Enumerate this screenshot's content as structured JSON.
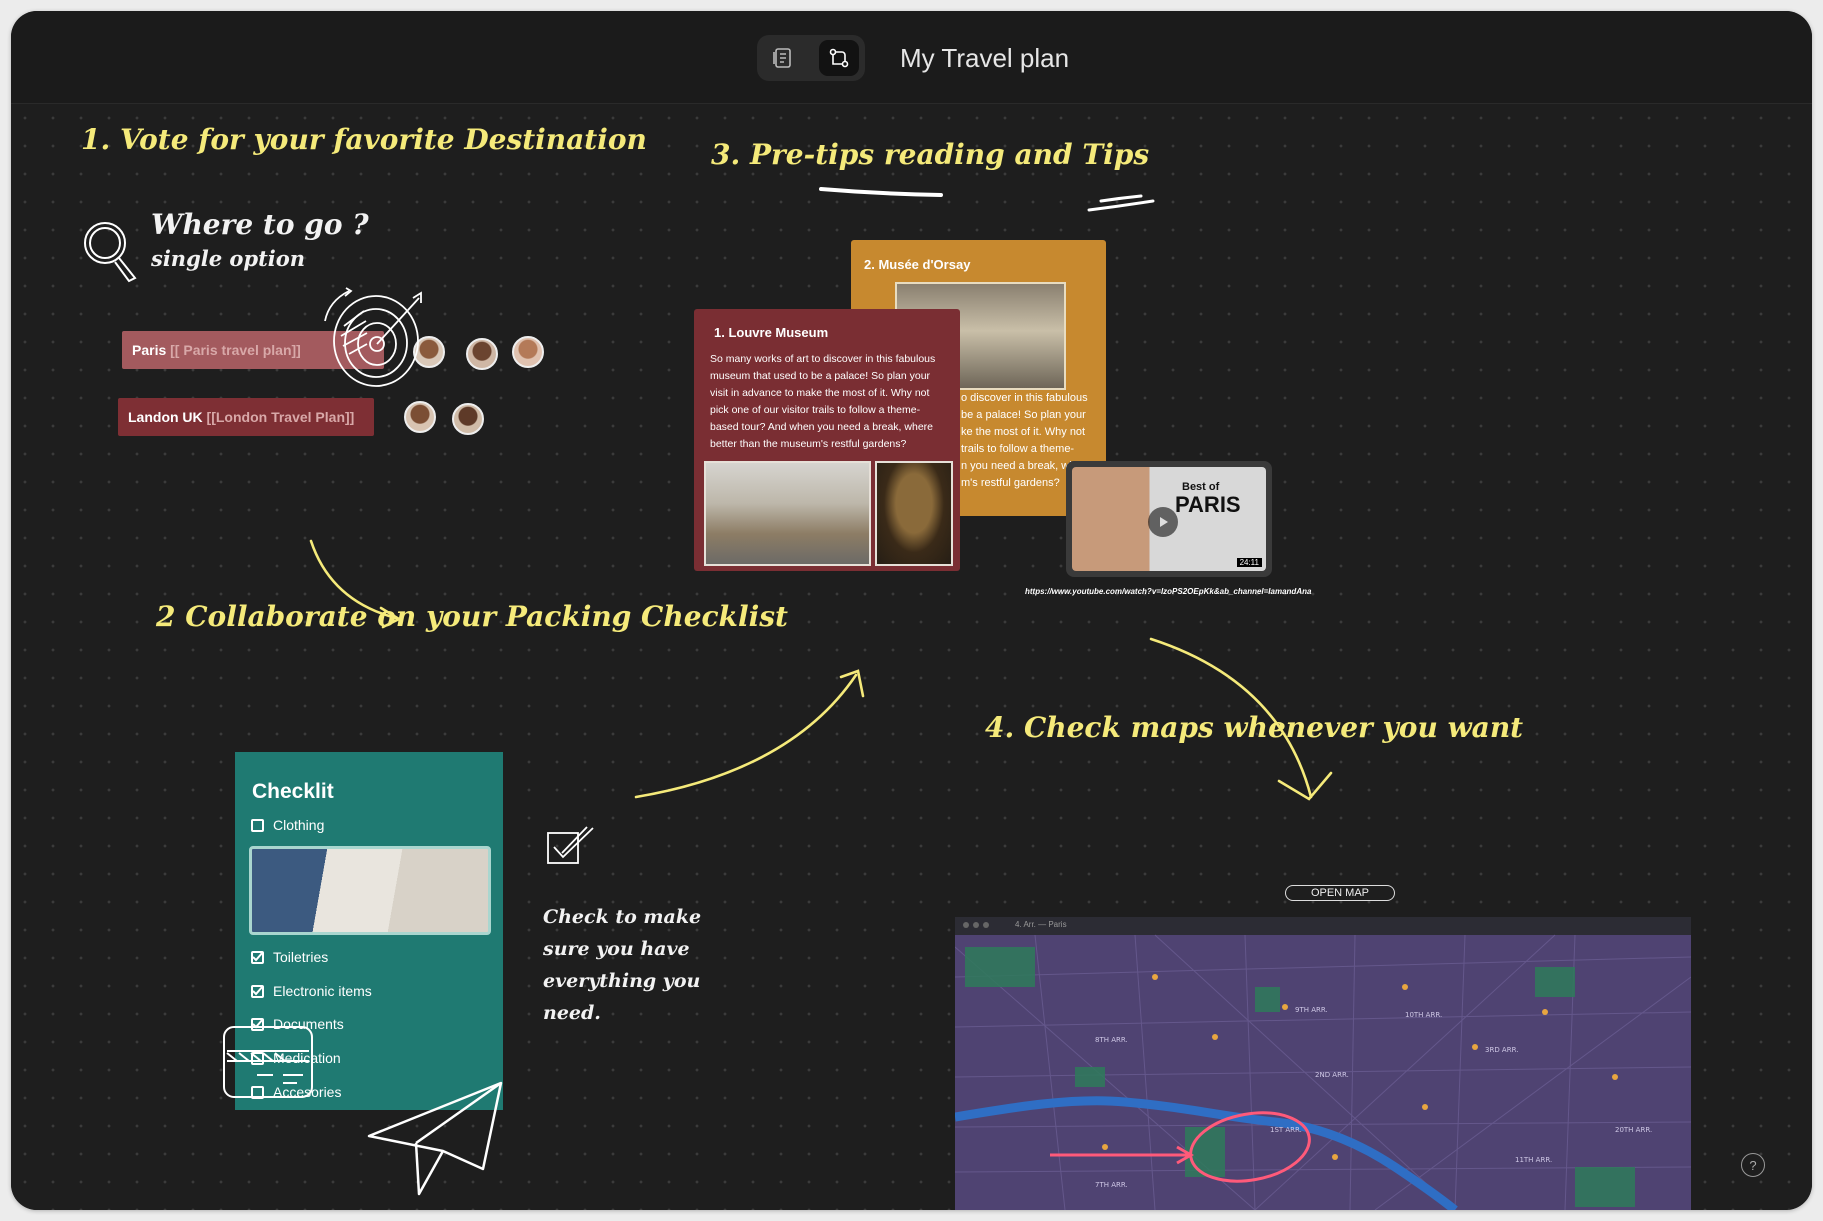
{
  "app": {
    "title": "My Travel plan",
    "view_buttons": [
      "doc-view",
      "whiteboard-view"
    ],
    "active_view": "whiteboard-view"
  },
  "section1": {
    "heading": "1. Vote for your favorite Destination",
    "question": "Where to go ?",
    "subtitle": "single option",
    "options": [
      {
        "name": "Paris",
        "link": "[[ Paris travel plan]]",
        "votes": 3,
        "color": "#a35a5e"
      },
      {
        "name": "Landon UK",
        "link": "[[London Travel Plan]]",
        "votes": 2,
        "color": "#7e2f34"
      }
    ]
  },
  "section2": {
    "heading": "2 Collaborate on your Packing Checklist",
    "checklist_title": "Checklit",
    "items": [
      {
        "label": "Clothing",
        "checked": false
      },
      {
        "label": "Toiletries",
        "checked": true
      },
      {
        "label": "Electronic items",
        "checked": true
      },
      {
        "label": "Documents",
        "checked": true
      },
      {
        "label": "Medication",
        "checked": false
      },
      {
        "label": "Accesories",
        "checked": false
      }
    ],
    "note_lines": [
      "Check to make",
      "sure you have",
      "everything you",
      "need."
    ],
    "color": "#1f7a72"
  },
  "section3": {
    "heading": "3. Pre-tips reading and Tips",
    "card_louvre": {
      "title": "1. Louvre Museum",
      "text_lines": [
        "So many works of art to discover in this fabulous",
        "museum that used to be a palace! So plan your",
        "visit in advance to make the most of it. Why not",
        "pick one of our visitor trails to follow a theme-",
        "based tour? And when you need a break, where",
        "better than the museum's restful gardens?"
      ],
      "color": "#7a2e33"
    },
    "card_orsay": {
      "title": "2. Musée d'Orsay",
      "text_lines": [
        "o discover in this fabulous",
        "be a palace! So plan your",
        "ke the most of it. Why not",
        "trails to follow a theme-",
        "n you need a break, wh",
        "m's restful gardens?"
      ],
      "color": "#c7892f"
    },
    "video": {
      "caption_top": "Best of",
      "caption_main": "PARIS",
      "duration": "24:11",
      "url": "https://www.youtube.com/watch?v=IzoPS2OEpKk&ab_channel=IamandAna"
    }
  },
  "section4": {
    "heading": "4. Check maps whenever you want",
    "open_map_label": "OPEN MAP",
    "map_window_title": "4. Arr. — Paris",
    "map_labels": [
      "1ST ARR.",
      "2ND ARR.",
      "3RD ARR.",
      "7TH ARR.",
      "8TH ARR.",
      "9TH ARR.",
      "10TH ARR.",
      "11TH ARR.",
      "20TH ARR."
    ]
  },
  "help_label": "?",
  "colors": {
    "accent_yellow": "#f5ea7a",
    "background": "#1e1e1e"
  }
}
